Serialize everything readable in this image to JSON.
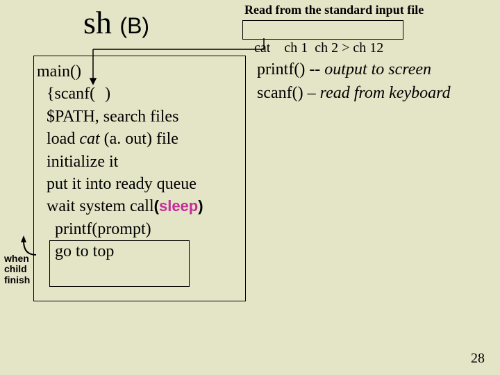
{
  "title": {
    "main": "sh",
    "suffix": "(B)"
  },
  "stdin_label": "Read from the standard input file",
  "command": {
    "cat": "cat",
    "args": "ch 1  ch 2 > ch 12"
  },
  "code": {
    "l1": "main()",
    "l2a": "{scanf(",
    "l2b": ")",
    "l3": "$PATH, search files",
    "l4a": "load ",
    "l4b": "cat",
    "l4c": " (a. out) file",
    "l5": "initialize it",
    "l6": "put it into ready queue",
    "l7a": "wait system call",
    "l7b": "(",
    "l7c": "sleep",
    "l7d": ")",
    "l8": "printf(prompt)",
    "l9": "go to top"
  },
  "notes": {
    "line1a": "printf()",
    "line1b": " -- ",
    "line1c": "output to screen",
    "line2a": "scanf()",
    "line2b": " – ",
    "line2c": "read from keyboard"
  },
  "side": {
    "when": "when",
    "child": "child",
    "finish": "finish"
  },
  "page": "28"
}
